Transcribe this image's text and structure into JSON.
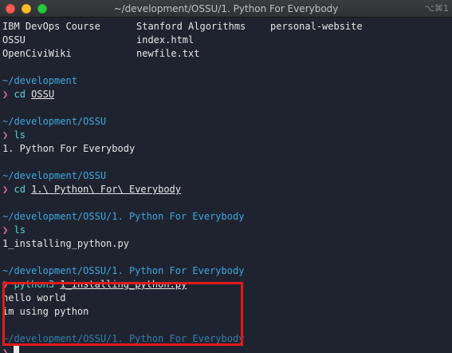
{
  "window": {
    "title": "~/development/OSSU/1. Python For Everybody",
    "shortcut": "⌥⌘1"
  },
  "ls_output": {
    "row1": [
      "IBM DevOps Course",
      "Stanford Algorithms",
      "personal-website"
    ],
    "row2": [
      "OSSU",
      "index.html"
    ],
    "row3": [
      "OpenCiviWiki",
      "newfile.txt"
    ]
  },
  "prompt_symbol": "❯",
  "blocks": [
    {
      "path": "~/development",
      "cmd": "cd",
      "arg": "OSSU"
    },
    {
      "path": "~/development/OSSU",
      "cmd": "ls",
      "arg": "",
      "output": [
        "1. Python For Everybody"
      ]
    },
    {
      "path": "~/development/OSSU",
      "cmd": "cd",
      "arg": "1.\\ Python\\ For\\ Everybody"
    },
    {
      "path": "~/development/OSSU/1. Python For Everybody",
      "cmd": "ls",
      "arg": "",
      "output": [
        "1_installing_python.py"
      ]
    },
    {
      "path": "~/development/OSSU/1. Python For Everybody",
      "cmd": "python3",
      "arg": "1_installing_python.py",
      "output": [
        "hello world",
        "im using python"
      ]
    },
    {
      "path": "~/development/OSSU/1. Python For Everybody"
    }
  ],
  "colors": {
    "background": "#1f2330",
    "path": "#3fa7dc",
    "prompt": "#e06c9f",
    "command": "#56d6d6",
    "highlight": "#e01b1b"
  }
}
